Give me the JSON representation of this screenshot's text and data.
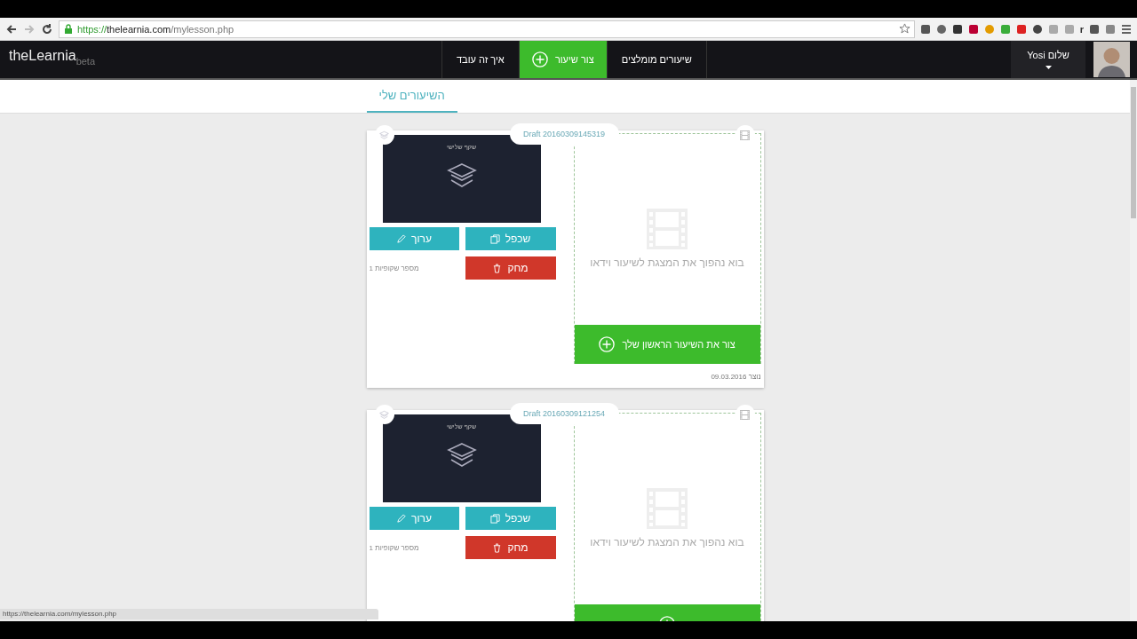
{
  "browser": {
    "url": {
      "scheme": "https://",
      "host": "thelearnia.com",
      "path": "/mylesson.php"
    },
    "extension_text": "r"
  },
  "navbar": {
    "logo": "theLearnia",
    "logo_tag": "beta",
    "items": [
      {
        "label": "שיעורים מומלצים",
        "kind": "link"
      },
      {
        "label": "צור שיעור",
        "kind": "primary"
      },
      {
        "label": "איך זה עובד",
        "kind": "link"
      }
    ],
    "user": {
      "greeting": "שלום Yosi"
    }
  },
  "tabs": [
    {
      "label": "השיעורים שלי",
      "selected": true
    }
  ],
  "lessons": [
    {
      "draft": "Draft 20160309145319",
      "thumb_title": "שקף שלישי",
      "edit": "ערוך",
      "duplicate": "שכפל",
      "delete": "מחק",
      "slides": "מספר שקופיות 1",
      "video_hint": "בוא נהפוך את המצגת לשיעור וידאו",
      "cta": "צור את השיעור הראשון שלך",
      "created": "נוצר 09.03.2016"
    },
    {
      "draft": "Draft 20160309121254",
      "thumb_title": "שקף שלישי",
      "edit": "ערוך",
      "duplicate": "שכפל",
      "delete": "מחק",
      "slides": "מספר שקופיות 1",
      "video_hint": "בוא נהפוך את המצגת לשיעור וידאו"
    }
  ],
  "status_bar": {
    "url": "https://thelearnia.com/mylesson.php"
  }
}
